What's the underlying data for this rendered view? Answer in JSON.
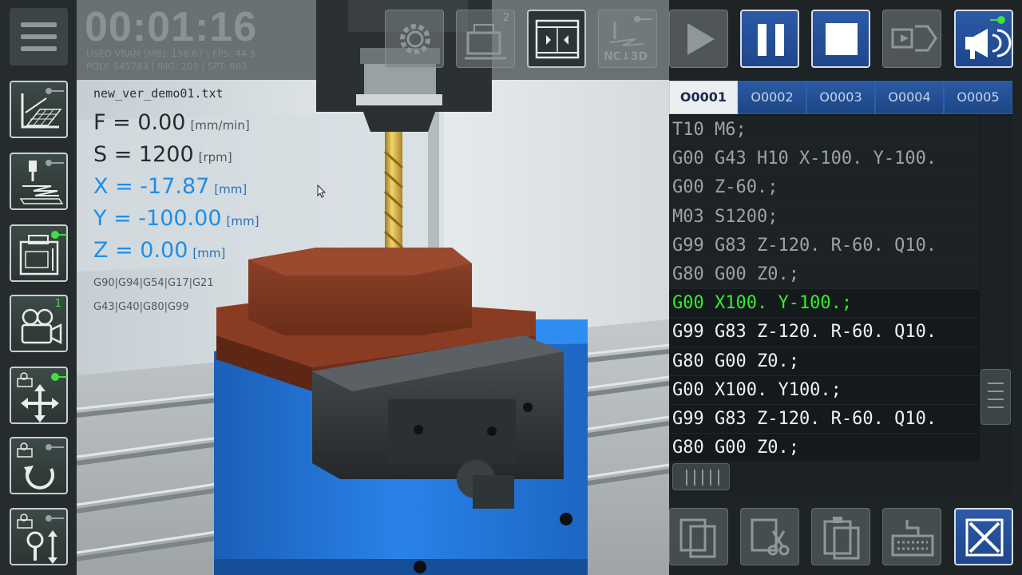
{
  "status": {
    "timer": "00:01:16",
    "line1": "USED VRAM [MB]: 158.67 | FPS: 44.5",
    "line2": "POLY: 545783 | IMG: 205 | SPT: 803"
  },
  "program": {
    "filename": "new_ver_demo01.txt"
  },
  "readouts": {
    "feed": {
      "label": "F = 0.00",
      "unit": "[mm/min]"
    },
    "spindle": {
      "label": "S = 1200",
      "unit": "[rpm]"
    },
    "x": {
      "label": "X = -17.87",
      "unit": "[mm]"
    },
    "y": {
      "label": "Y = -100.00",
      "unit": "[mm]"
    },
    "z": {
      "label": "Z = 0.00",
      "unit": "[mm]"
    }
  },
  "modal_codes": {
    "row1": "G90|G94|G54|G17|G21",
    "row2": "G43|G40|G80|G99"
  },
  "left_toolbar": {
    "camera_badge": "1"
  },
  "top_toolbar": {
    "workpiece_badge": "2",
    "nc3d_label": "NC↓3D"
  },
  "code_tabs": [
    "O0001",
    "O0002",
    "O0003",
    "O0004",
    "O0005"
  ],
  "code_lines": [
    "T10 M6;",
    "G00 G43 H10 X-100. Y-100.",
    "G00 Z-60.;",
    "M03 S1200;",
    "G99 G83 Z-120. R-60. Q10.",
    "G80 G00 Z0.;",
    "G00 X100. Y-100.;",
    "G99 G83 Z-120. R-60. Q10.",
    "G80 G00 Z0.;",
    "G00 X100. Y100.;",
    "G99 G83 Z-120. R-60. Q10.",
    "G80 G00 Z0.;"
  ],
  "current_line_index": 6,
  "colors": {
    "accent_blue": "#1f5ab0",
    "current_line": "#2ef02e",
    "readout_blue": "#1f8ee6",
    "vise_blue": "#1f6fd1",
    "workpiece": "#7a3520"
  },
  "icons": {
    "left": [
      "menu-icon",
      "coordinate-plane-icon",
      "toolpath-icon",
      "machine-icon",
      "camera-icon",
      "move-camera-icon",
      "rotate-camera-icon",
      "zoom-camera-icon"
    ],
    "top": [
      "settings-icon",
      "workpiece-icon",
      "door-icon",
      "nc-3d-icon",
      "play-icon",
      "pause-icon",
      "stop-icon",
      "step-icon",
      "sound-icon"
    ],
    "bottom": [
      "copy-icon",
      "cut-icon",
      "paste-icon",
      "keyboard-icon",
      "close-icon"
    ]
  }
}
